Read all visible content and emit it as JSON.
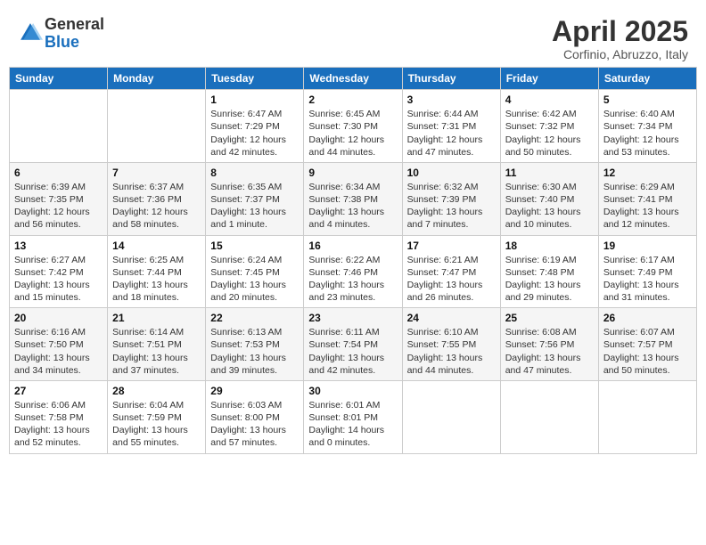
{
  "header": {
    "logo_general": "General",
    "logo_blue": "Blue",
    "title": "April 2025",
    "subtitle": "Corfinio, Abruzzo, Italy"
  },
  "days_of_week": [
    "Sunday",
    "Monday",
    "Tuesday",
    "Wednesday",
    "Thursday",
    "Friday",
    "Saturday"
  ],
  "weeks": [
    [
      {
        "day": null
      },
      {
        "day": null
      },
      {
        "day": 1,
        "sunrise": "Sunrise: 6:47 AM",
        "sunset": "Sunset: 7:29 PM",
        "daylight": "Daylight: 12 hours and 42 minutes."
      },
      {
        "day": 2,
        "sunrise": "Sunrise: 6:45 AM",
        "sunset": "Sunset: 7:30 PM",
        "daylight": "Daylight: 12 hours and 44 minutes."
      },
      {
        "day": 3,
        "sunrise": "Sunrise: 6:44 AM",
        "sunset": "Sunset: 7:31 PM",
        "daylight": "Daylight: 12 hours and 47 minutes."
      },
      {
        "day": 4,
        "sunrise": "Sunrise: 6:42 AM",
        "sunset": "Sunset: 7:32 PM",
        "daylight": "Daylight: 12 hours and 50 minutes."
      },
      {
        "day": 5,
        "sunrise": "Sunrise: 6:40 AM",
        "sunset": "Sunset: 7:34 PM",
        "daylight": "Daylight: 12 hours and 53 minutes."
      }
    ],
    [
      {
        "day": 6,
        "sunrise": "Sunrise: 6:39 AM",
        "sunset": "Sunset: 7:35 PM",
        "daylight": "Daylight: 12 hours and 56 minutes."
      },
      {
        "day": 7,
        "sunrise": "Sunrise: 6:37 AM",
        "sunset": "Sunset: 7:36 PM",
        "daylight": "Daylight: 12 hours and 58 minutes."
      },
      {
        "day": 8,
        "sunrise": "Sunrise: 6:35 AM",
        "sunset": "Sunset: 7:37 PM",
        "daylight": "Daylight: 13 hours and 1 minute."
      },
      {
        "day": 9,
        "sunrise": "Sunrise: 6:34 AM",
        "sunset": "Sunset: 7:38 PM",
        "daylight": "Daylight: 13 hours and 4 minutes."
      },
      {
        "day": 10,
        "sunrise": "Sunrise: 6:32 AM",
        "sunset": "Sunset: 7:39 PM",
        "daylight": "Daylight: 13 hours and 7 minutes."
      },
      {
        "day": 11,
        "sunrise": "Sunrise: 6:30 AM",
        "sunset": "Sunset: 7:40 PM",
        "daylight": "Daylight: 13 hours and 10 minutes."
      },
      {
        "day": 12,
        "sunrise": "Sunrise: 6:29 AM",
        "sunset": "Sunset: 7:41 PM",
        "daylight": "Daylight: 13 hours and 12 minutes."
      }
    ],
    [
      {
        "day": 13,
        "sunrise": "Sunrise: 6:27 AM",
        "sunset": "Sunset: 7:42 PM",
        "daylight": "Daylight: 13 hours and 15 minutes."
      },
      {
        "day": 14,
        "sunrise": "Sunrise: 6:25 AM",
        "sunset": "Sunset: 7:44 PM",
        "daylight": "Daylight: 13 hours and 18 minutes."
      },
      {
        "day": 15,
        "sunrise": "Sunrise: 6:24 AM",
        "sunset": "Sunset: 7:45 PM",
        "daylight": "Daylight: 13 hours and 20 minutes."
      },
      {
        "day": 16,
        "sunrise": "Sunrise: 6:22 AM",
        "sunset": "Sunset: 7:46 PM",
        "daylight": "Daylight: 13 hours and 23 minutes."
      },
      {
        "day": 17,
        "sunrise": "Sunrise: 6:21 AM",
        "sunset": "Sunset: 7:47 PM",
        "daylight": "Daylight: 13 hours and 26 minutes."
      },
      {
        "day": 18,
        "sunrise": "Sunrise: 6:19 AM",
        "sunset": "Sunset: 7:48 PM",
        "daylight": "Daylight: 13 hours and 29 minutes."
      },
      {
        "day": 19,
        "sunrise": "Sunrise: 6:17 AM",
        "sunset": "Sunset: 7:49 PM",
        "daylight": "Daylight: 13 hours and 31 minutes."
      }
    ],
    [
      {
        "day": 20,
        "sunrise": "Sunrise: 6:16 AM",
        "sunset": "Sunset: 7:50 PM",
        "daylight": "Daylight: 13 hours and 34 minutes."
      },
      {
        "day": 21,
        "sunrise": "Sunrise: 6:14 AM",
        "sunset": "Sunset: 7:51 PM",
        "daylight": "Daylight: 13 hours and 37 minutes."
      },
      {
        "day": 22,
        "sunrise": "Sunrise: 6:13 AM",
        "sunset": "Sunset: 7:53 PM",
        "daylight": "Daylight: 13 hours and 39 minutes."
      },
      {
        "day": 23,
        "sunrise": "Sunrise: 6:11 AM",
        "sunset": "Sunset: 7:54 PM",
        "daylight": "Daylight: 13 hours and 42 minutes."
      },
      {
        "day": 24,
        "sunrise": "Sunrise: 6:10 AM",
        "sunset": "Sunset: 7:55 PM",
        "daylight": "Daylight: 13 hours and 44 minutes."
      },
      {
        "day": 25,
        "sunrise": "Sunrise: 6:08 AM",
        "sunset": "Sunset: 7:56 PM",
        "daylight": "Daylight: 13 hours and 47 minutes."
      },
      {
        "day": 26,
        "sunrise": "Sunrise: 6:07 AM",
        "sunset": "Sunset: 7:57 PM",
        "daylight": "Daylight: 13 hours and 50 minutes."
      }
    ],
    [
      {
        "day": 27,
        "sunrise": "Sunrise: 6:06 AM",
        "sunset": "Sunset: 7:58 PM",
        "daylight": "Daylight: 13 hours and 52 minutes."
      },
      {
        "day": 28,
        "sunrise": "Sunrise: 6:04 AM",
        "sunset": "Sunset: 7:59 PM",
        "daylight": "Daylight: 13 hours and 55 minutes."
      },
      {
        "day": 29,
        "sunrise": "Sunrise: 6:03 AM",
        "sunset": "Sunset: 8:00 PM",
        "daylight": "Daylight: 13 hours and 57 minutes."
      },
      {
        "day": 30,
        "sunrise": "Sunrise: 6:01 AM",
        "sunset": "Sunset: 8:01 PM",
        "daylight": "Daylight: 14 hours and 0 minutes."
      },
      {
        "day": null
      },
      {
        "day": null
      },
      {
        "day": null
      }
    ]
  ]
}
